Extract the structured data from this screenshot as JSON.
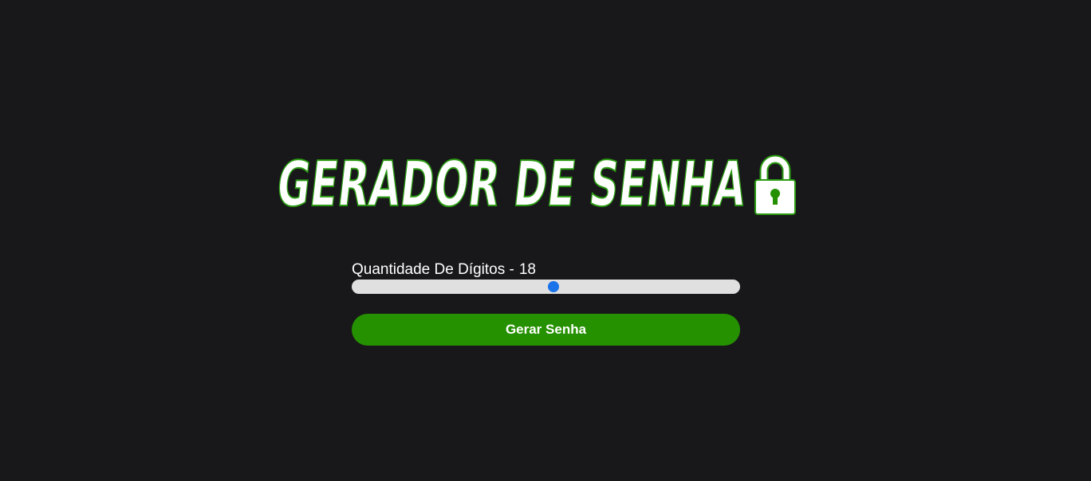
{
  "header": {
    "title": "GERADOR DE SENHA",
    "icon": "lock-icon"
  },
  "slider": {
    "label": "Quantidade De Dígitos -",
    "value": "18",
    "fraction": 0.52
  },
  "button": {
    "label": "Gerar Senha"
  },
  "colors": {
    "background": "#18181a",
    "accent": "#259100",
    "title_outline": "#2a9b12",
    "slider_track": "#e0e0e0",
    "slider_thumb": "#1a73e8"
  }
}
